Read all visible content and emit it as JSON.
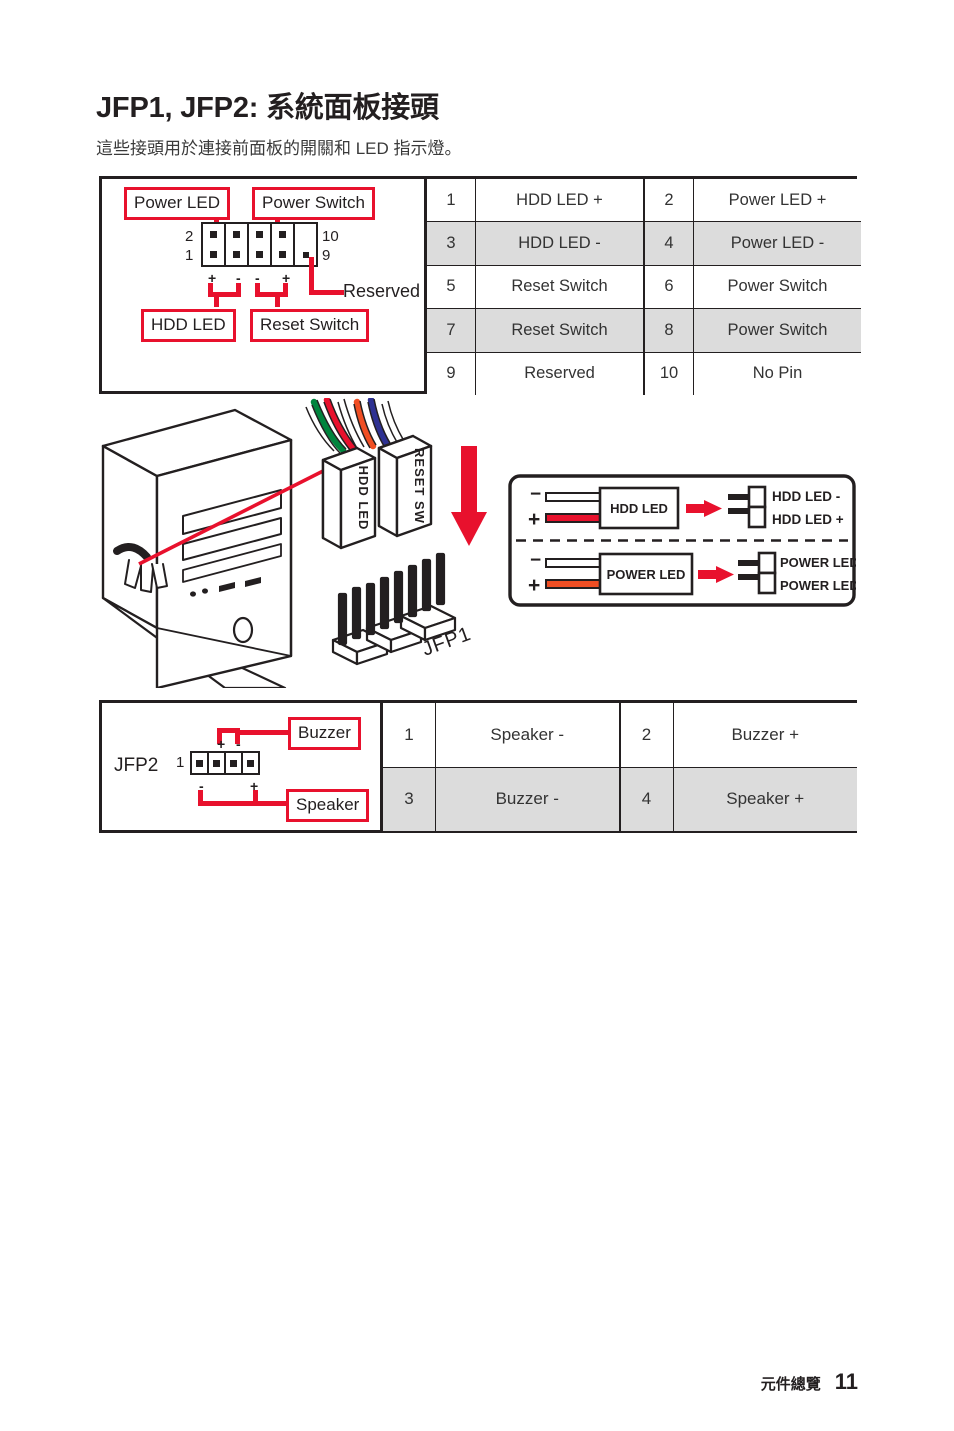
{
  "page": {
    "title": "JFP1, JFP2: 系統面板接頭",
    "subtitle": "這些接頭用於連接前面板的開關和 LED 指示燈。",
    "footer_section": "元件總覽",
    "footer_page": "11"
  },
  "colors": {
    "accent_red": "#e8112d",
    "ink": "#231f20",
    "row_shade": "#dcdcdc",
    "wire_green": "#00843d",
    "wire_red": "#e8112d",
    "wire_orange": "#f04e23",
    "wire_blue": "#2e3192",
    "wire_white": "#ffffff"
  },
  "jfp1": {
    "name": "JFP1",
    "diagram": {
      "callouts": {
        "power_led": "Power LED",
        "power_switch": "Power Switch",
        "hdd_led": "HDD LED",
        "reset_switch": "Reset Switch",
        "reserved": "Reserved"
      },
      "pin_numbers": {
        "top_left": "2",
        "bottom_left": "1",
        "top_right": "10",
        "bottom_right": "9"
      },
      "top_signs": [
        "+",
        "-",
        "+",
        "-"
      ],
      "bottom_signs": [
        "+",
        "-",
        "-",
        "+"
      ]
    },
    "table": {
      "rows": [
        {
          "shade": false,
          "left_num": "1",
          "left_label": "HDD LED +",
          "right_num": "2",
          "right_label": "Power LED +"
        },
        {
          "shade": true,
          "left_num": "3",
          "left_label": "HDD LED -",
          "right_num": "4",
          "right_label": "Power LED -"
        },
        {
          "shade": false,
          "left_num": "5",
          "left_label": "Reset Switch",
          "right_num": "6",
          "right_label": "Power Switch"
        },
        {
          "shade": true,
          "left_num": "7",
          "left_label": "Reset Switch",
          "right_num": "8",
          "right_label": "Power Switch"
        },
        {
          "shade": false,
          "left_num": "9",
          "left_label": "Reserved",
          "right_num": "10",
          "right_label": "No Pin"
        }
      ]
    }
  },
  "illustration": {
    "connector_plug_1": "HDD LED",
    "connector_plug_2": "RESET SW",
    "header_label": "JFP1"
  },
  "polarity_guide": {
    "rows": [
      {
        "minus_sign": "−",
        "plus_sign": "+",
        "device_label": "HDD LED",
        "pin_minus": "HDD LED -",
        "pin_plus": "HDD LED +",
        "wire_color": "#e8112d"
      },
      {
        "minus_sign": "−",
        "plus_sign": "+",
        "device_label": "POWER LED",
        "pin_minus": "POWER LED -",
        "pin_plus": "POWER LED +",
        "wire_color": "#f04e23"
      }
    ]
  },
  "jfp2": {
    "name": "JFP2",
    "diagram": {
      "callouts": {
        "buzzer": "Buzzer",
        "speaker": "Speaker"
      },
      "pin_number_first": "1",
      "top_signs": [
        "+",
        "-"
      ],
      "bottom_signs": [
        "-",
        "+"
      ]
    },
    "table": {
      "rows": [
        {
          "shade": false,
          "left_num": "1",
          "left_label": "Speaker -",
          "right_num": "2",
          "right_label": "Buzzer +"
        },
        {
          "shade": true,
          "left_num": "3",
          "left_label": "Buzzer -",
          "right_num": "4",
          "right_label": "Speaker +"
        }
      ]
    }
  }
}
